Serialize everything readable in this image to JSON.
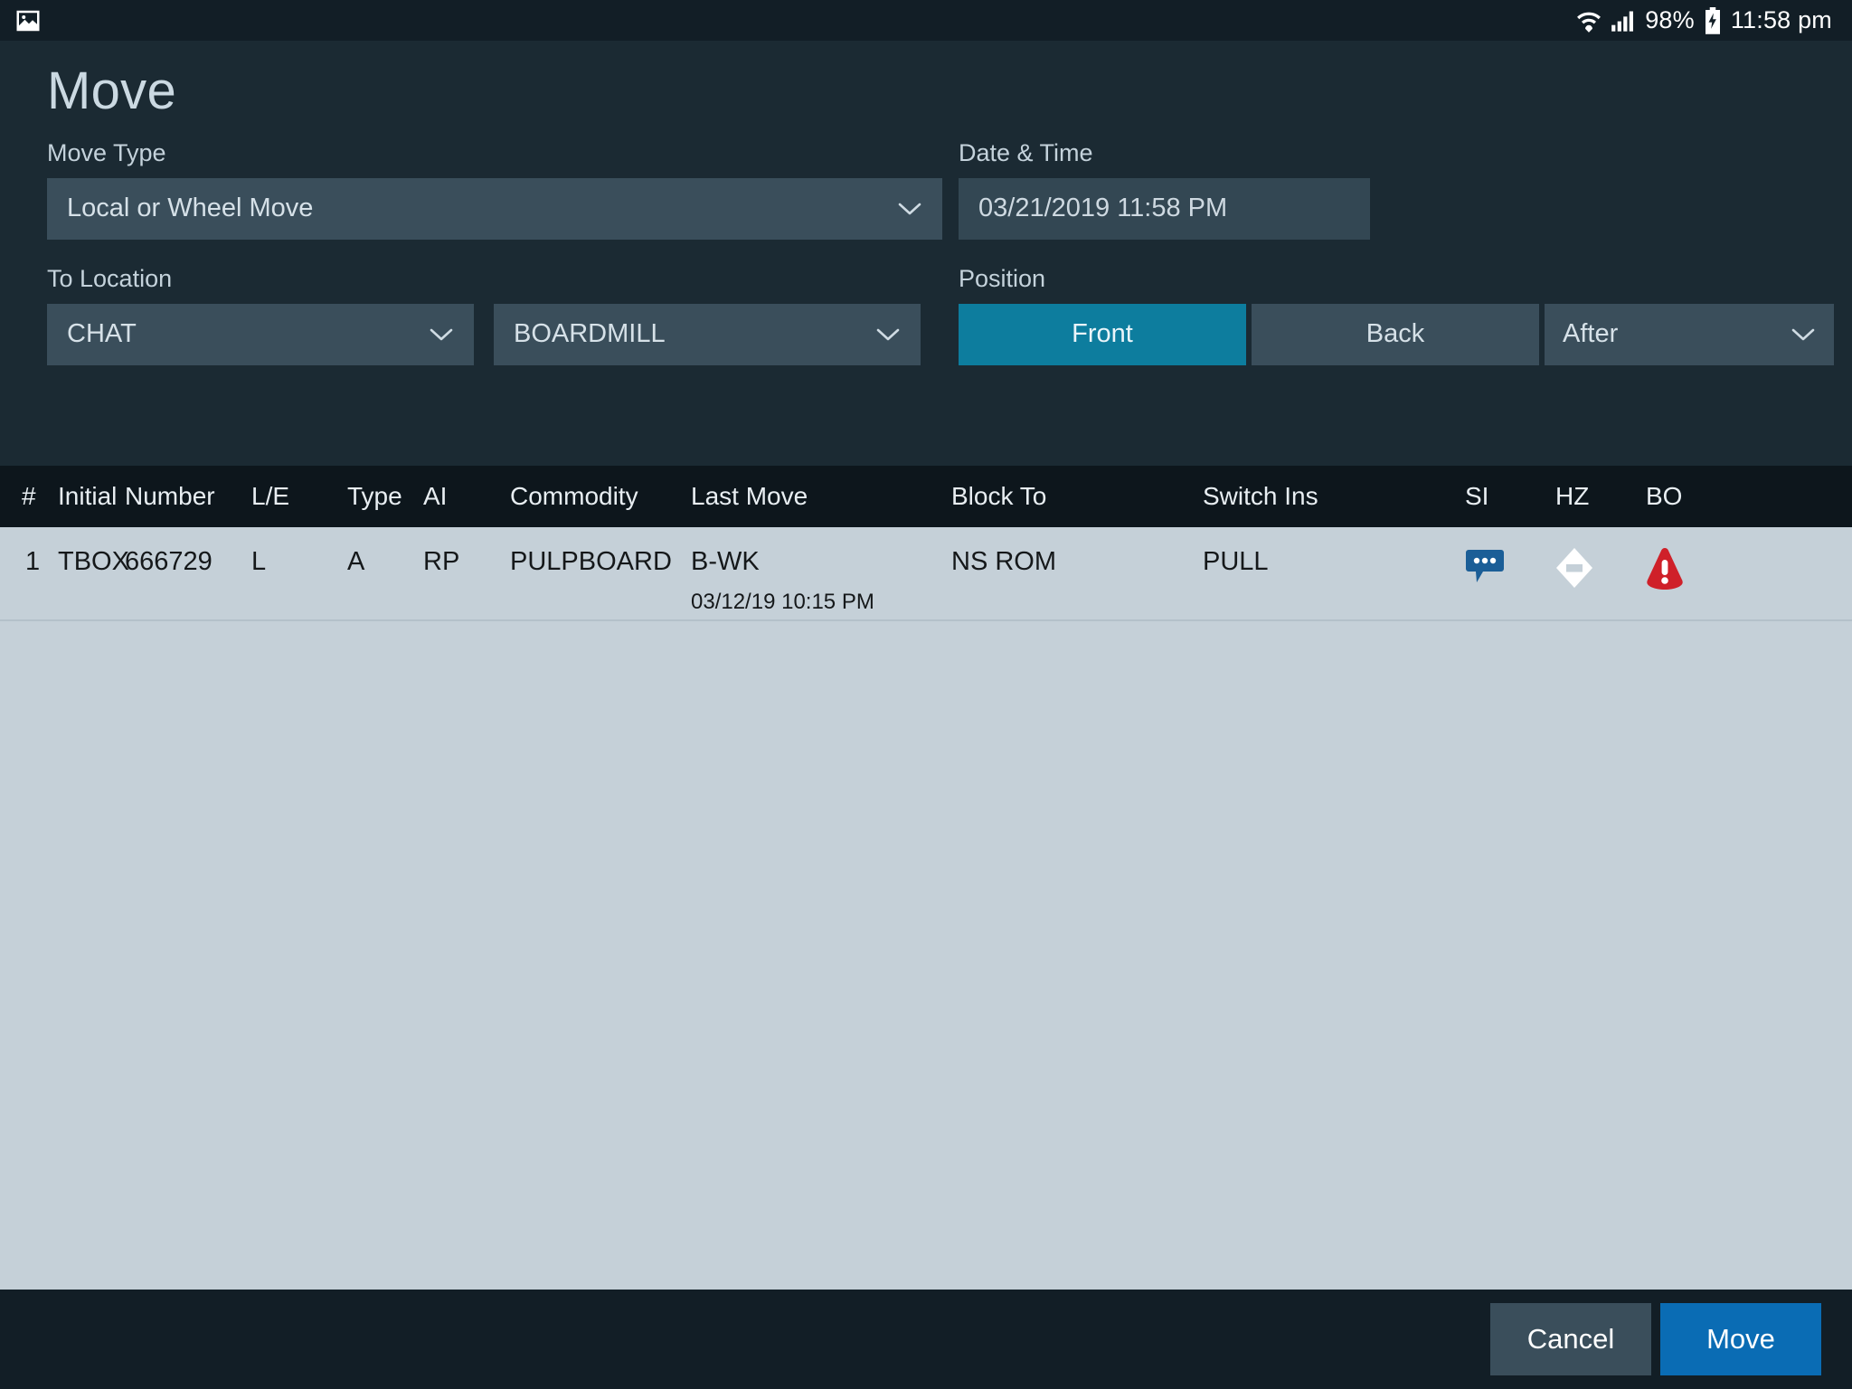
{
  "statusbar": {
    "left_icon": "photo-icon",
    "wifi_icon": "wifi-icon",
    "signal_icon": "signal-bars-icon",
    "battery_percent": "98%",
    "battery_icon": "battery-charging-icon",
    "clock": "11:58 pm"
  },
  "page": {
    "title": "Move"
  },
  "form": {
    "move_type_label": "Move Type",
    "move_type_value": "Local or Wheel Move",
    "datetime_label": "Date & Time",
    "datetime_value": "03/21/2019 11:58 PM",
    "to_location_label": "To Location",
    "to_location_value": "CHAT",
    "to_track_value": "BOARDMILL",
    "position_label": "Position",
    "position_front": "Front",
    "position_back": "Back",
    "position_after": "After",
    "position_selected": "Front"
  },
  "table": {
    "columns": [
      "#",
      "Initial",
      "Number",
      "L/E",
      "Type",
      "AI",
      "Commodity",
      "Last Move",
      "Block To",
      "Switch Ins",
      "SI",
      "HZ",
      "BO"
    ],
    "rows": [
      {
        "num": "1",
        "initial": "TBOX",
        "number": "666729",
        "le": "L",
        "type": "A",
        "ai": "RP",
        "commodity": "PULPBOARD",
        "last_move": "B-WK",
        "last_move_time": "03/12/19 10:15 PM",
        "block_to": "NS ROM",
        "switch_ins": "PULL",
        "si_icon": "comment-bubble-icon",
        "hz_icon": "hazmat-placard-icon",
        "bo_icon": "warning-alert-icon"
      }
    ]
  },
  "footer": {
    "cancel_label": "Cancel",
    "move_label": "Move"
  },
  "colors": {
    "page_background": "#1b2a33",
    "statusbar_background": "#121e26",
    "field_background": "#3a4e5b",
    "accent_teal": "#0d7d9e",
    "accent_blue": "#0a6cb4",
    "table_header_background": "#0d161c",
    "table_body_background": "#c5d0d8",
    "si_icon_color": "#1b5e97",
    "bo_icon_color": "#cf2029",
    "text_light": "#cbd9e2"
  }
}
